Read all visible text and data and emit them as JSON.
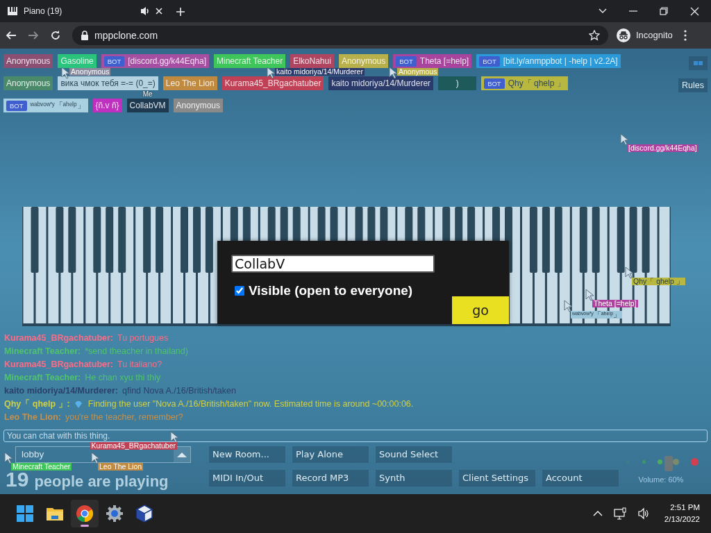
{
  "browser": {
    "tab": {
      "title": "Piano (19)",
      "audio": true
    },
    "address": "mppclone.com",
    "incognito_label": "Incognito"
  },
  "participants": [
    {
      "name": "Anonymous",
      "color": "#8a4f72"
    },
    {
      "name": "Gasoline",
      "color": "#2bc47c"
    },
    {
      "name": "[discord.gg/k44Eqha]",
      "color": "#a64fa2",
      "badge": "BOT"
    },
    {
      "name": "Minecraft Teacher",
      "color": "#3fc65a"
    },
    {
      "name": "ElkoNahui",
      "color": "#b04562"
    },
    {
      "name": "Anonymous",
      "color": "#b8b04a"
    },
    {
      "name": "Theta [=help]",
      "color": "#a8449e",
      "badge": "BOT"
    },
    {
      "name": "[bit.ly/anmppbot | -help | v2.2A]",
      "color": "#2a9ad8",
      "badge": "BOT"
    },
    {
      "name": "Anonymous",
      "color": "#4a8a6a"
    },
    {
      "name": "вика чмок тебя =-= (0_=)",
      "color": "#b4d2e0"
    },
    {
      "name": "Leo The Lion",
      "color": "#c08a40"
    },
    {
      "name": "Kurama45_BRgachatuber",
      "color": "#c04055"
    },
    {
      "name": "kaito midoriya/14/Murderer",
      "color": "#2a3a6a"
    },
    {
      "name": ")",
      "color": "#1f5a5a"
    },
    {
      "name": "Qhy「 qhelp 」",
      "color": "#b8b840",
      "badge": "BOT"
    },
    {
      "name": "ʷᵃᵇᵛᵒʷ'ʸ「ᵃʰᵉˡᵖ」",
      "color": "#a8d0e0",
      "badge": "BOT"
    },
    {
      "name": "{ñ.v ñ}",
      "color": "#c030c0"
    },
    {
      "name": "CollabVM",
      "color": "#1e3a50",
      "me_label": "Me"
    },
    {
      "name": "Anonymous",
      "color": "#8a8a8a"
    }
  ],
  "rules_button": "Rules",
  "chat": [
    {
      "user": "Kurama45_BRgachatuber:",
      "text": "Tu portugues",
      "color": "#ff6a84"
    },
    {
      "user": "Minecraft Teacher:",
      "text": "*send theacher in thailand)",
      "color": "#4fc46a"
    },
    {
      "user": "Kurama45_BRgachatuber:",
      "text": "Tu italiano?",
      "color": "#ff6a84"
    },
    {
      "user": "Minecraft Teacher:",
      "text": "He chan xyu thi thiy",
      "color": "#4fc46a"
    },
    {
      "user": "kaito midoriya/14/Murderer:",
      "text": "qfind Nova A./16/British/taken",
      "color": "#2a3f6a"
    },
    {
      "user": "Qhy「 qhelp 」:",
      "text": "Finding the user \"Nova A./16/British/taken\" now. Estimated time is around ~00:00:06.",
      "color": "#d0d048",
      "gem": true
    },
    {
      "user": "Leo The Lion:",
      "text": "you're the teacher, remember?",
      "color": "#c89048"
    }
  ],
  "room_dialog": {
    "name_value": "CollabV",
    "visible_label": "Visible (open to everyone)",
    "visible_checked": true,
    "go_button": "go"
  },
  "cursors": [
    {
      "label": "Anonymous",
      "color": "#8a8a9e"
    },
    {
      "label": "kaito midoriya/14/Murderer",
      "color": "#2a3a6a"
    },
    {
      "label": "Anonymous",
      "color": "#b8b04a"
    },
    {
      "label": "[discord.gg/k44Eqha]",
      "color": "#b040a0"
    },
    {
      "label": "Qhy「 qhelp 」",
      "color": "#b8b840"
    },
    {
      "label": "Theta [=help]",
      "color": "#b040a0"
    },
    {
      "label": "ʷᵃᵇᵛᵒʷ'ʸ「ᵃʰᵉˡᵖ」",
      "color": "#9cc6da"
    },
    {
      "label": "Kurama45_BRgachatuber",
      "color": "#c04055"
    },
    {
      "label": "Minecraft Teacher",
      "color": "#3fc65a"
    },
    {
      "label": "Leo The Lion",
      "color": "#c08a40"
    }
  ],
  "chat_input": {
    "placeholder": "You can chat with this thing."
  },
  "room_select": {
    "value": "lobby"
  },
  "player_count": "19",
  "player_count_label": "people are playing",
  "buttons": [
    {
      "label": "New Room..."
    },
    {
      "label": "Play Alone"
    },
    {
      "label": "Sound Select"
    },
    {
      "label": "MIDI In/Out"
    },
    {
      "label": "Record MP3"
    },
    {
      "label": "Synth"
    },
    {
      "label": "Client Settings"
    },
    {
      "label": "Account"
    }
  ],
  "volume": {
    "level": 0.6,
    "label": "Volume: 60%"
  },
  "taskbar": {
    "time": "2:51 PM",
    "date": "2/13/2022"
  }
}
